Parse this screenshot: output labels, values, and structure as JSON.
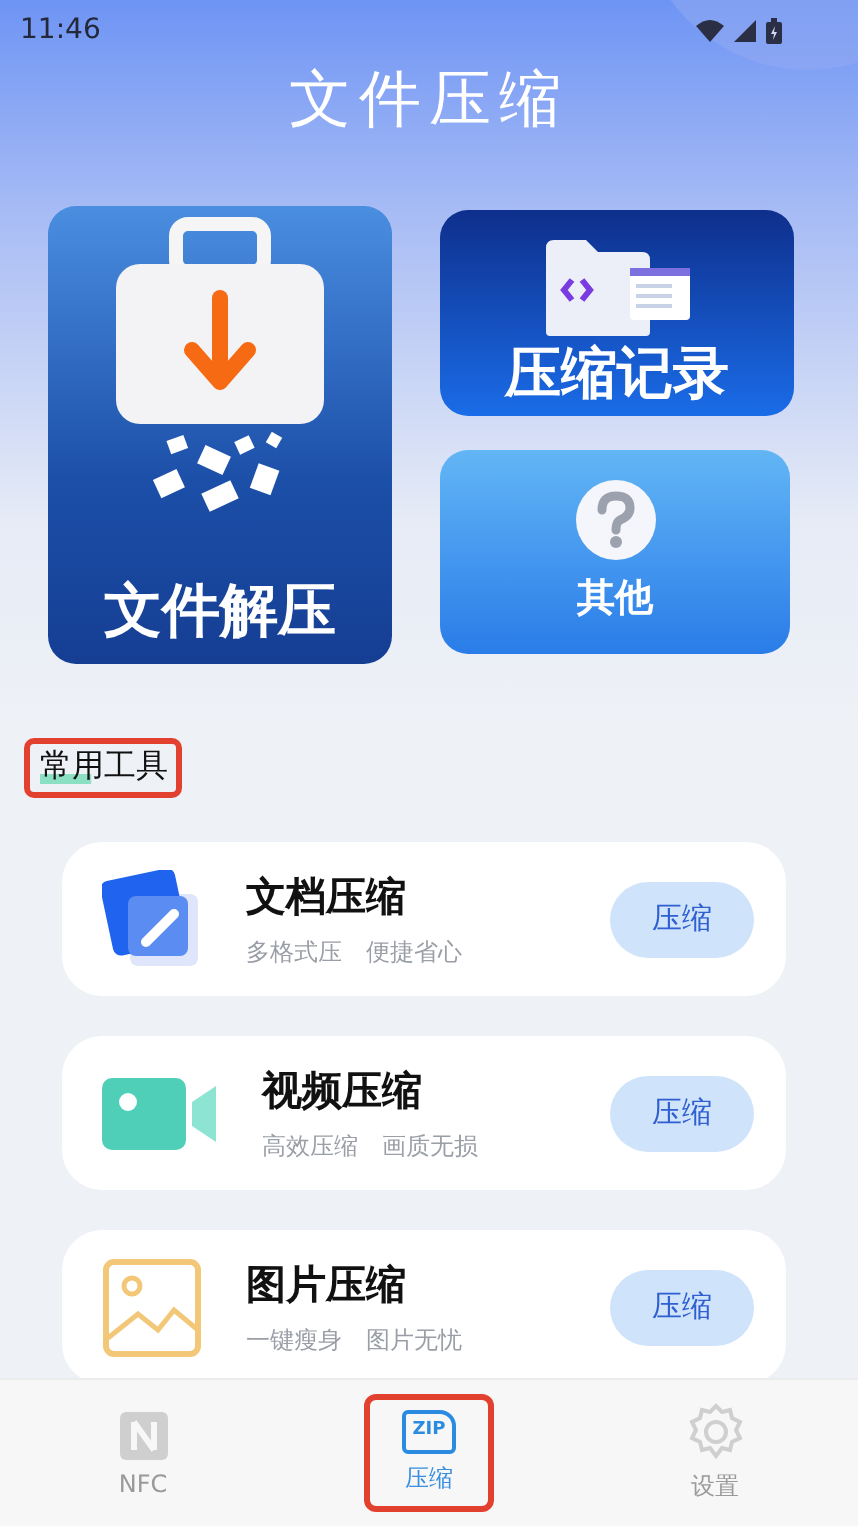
{
  "status_bar": {
    "time": "11:46"
  },
  "header": {
    "title": "文件压缩"
  },
  "feature_cards": [
    {
      "kind": "extract",
      "label": "文件解压"
    },
    {
      "kind": "history",
      "label": "压缩记录"
    },
    {
      "kind": "other",
      "label": "其他"
    }
  ],
  "section": {
    "title": "常用工具"
  },
  "tools": [
    {
      "kind": "document",
      "title": "文档压缩",
      "subtitle": "多格式压　便捷省心",
      "button": "压缩"
    },
    {
      "kind": "video",
      "title": "视频压缩",
      "subtitle": "高效压缩　画质无损",
      "button": "压缩"
    },
    {
      "kind": "image",
      "title": "图片压缩",
      "subtitle": "一键瘦身　图片无忧",
      "button": "压缩"
    }
  ],
  "bottom_nav": [
    {
      "kind": "nfc",
      "label": "NFC",
      "selected": false
    },
    {
      "kind": "zip",
      "label": "压缩",
      "icon_text": "ZIP",
      "selected": true
    },
    {
      "kind": "settings",
      "label": "设置",
      "selected": false
    }
  ]
}
